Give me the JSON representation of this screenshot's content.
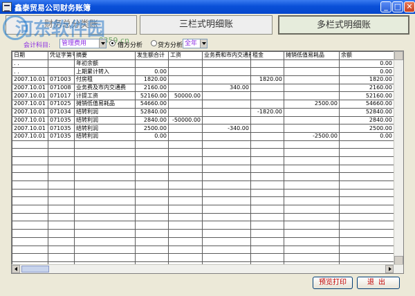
{
  "window": {
    "title": "鑫泰贸易公司财务账簿"
  },
  "tabs": [
    {
      "label": "财务总分类账"
    },
    {
      "label": "三栏式明细账"
    },
    {
      "label": "多栏式明细账"
    }
  ],
  "watermark": {
    "text": "河东软件园",
    "url": "www.pc0359.cn"
  },
  "filter": {
    "account_label": "会计科目:",
    "account_value": "管理费用",
    "debit_label": "借方分析",
    "credit_label": "贷方分析",
    "year_value": "全年"
  },
  "table": {
    "columns": [
      "日期",
      "凭证字第号",
      "摘要",
      "发生额合计",
      "工资",
      "业务费和市内交通费",
      "租金",
      "摊销低值易耗品",
      "余额"
    ],
    "rows": [
      [
        ". .",
        "",
        "年初余额",
        "",
        "",
        "",
        "",
        "",
        "0.00"
      ],
      [
        ". .",
        "",
        "上期累计转入",
        "0.00",
        "",
        "",
        "",
        "",
        "0.00"
      ],
      [
        "2007.10.01",
        "071003",
        "付房租",
        "1820.00",
        "",
        "",
        "1820.00",
        "",
        "1820.00"
      ],
      [
        "2007.10.01",
        "071008",
        "业务费及市内交通费",
        "2160.00",
        "",
        "340.00",
        "",
        "",
        "2160.00"
      ],
      [
        "2007.10.01",
        "071017",
        "计提工资",
        "52160.00",
        "50000.00",
        "",
        "",
        "",
        "52160.00"
      ],
      [
        "2007.10.01",
        "071025",
        "摊销低值易耗品",
        "54660.00",
        "",
        "",
        "",
        "2500.00",
        "54660.00"
      ],
      [
        "2007.10.01",
        "071034",
        "结转利润",
        "52840.00",
        "",
        "",
        "-1820.00",
        "",
        "52840.00"
      ],
      [
        "2007.10.01",
        "071035",
        "结转利润",
        "2840.00",
        "-50000.00",
        "",
        "",
        "",
        "2840.00"
      ],
      [
        "2007.10.01",
        "071035",
        "结转利润",
        "2500.00",
        "",
        "-340.00",
        "",
        "",
        "2500.00"
      ],
      [
        "2007.10.01",
        "071035",
        "结转利润",
        "0.00",
        "",
        "",
        "",
        "-2500.00",
        "0.00"
      ]
    ]
  },
  "buttons": {
    "print": "预览打印",
    "exit": "退出"
  }
}
